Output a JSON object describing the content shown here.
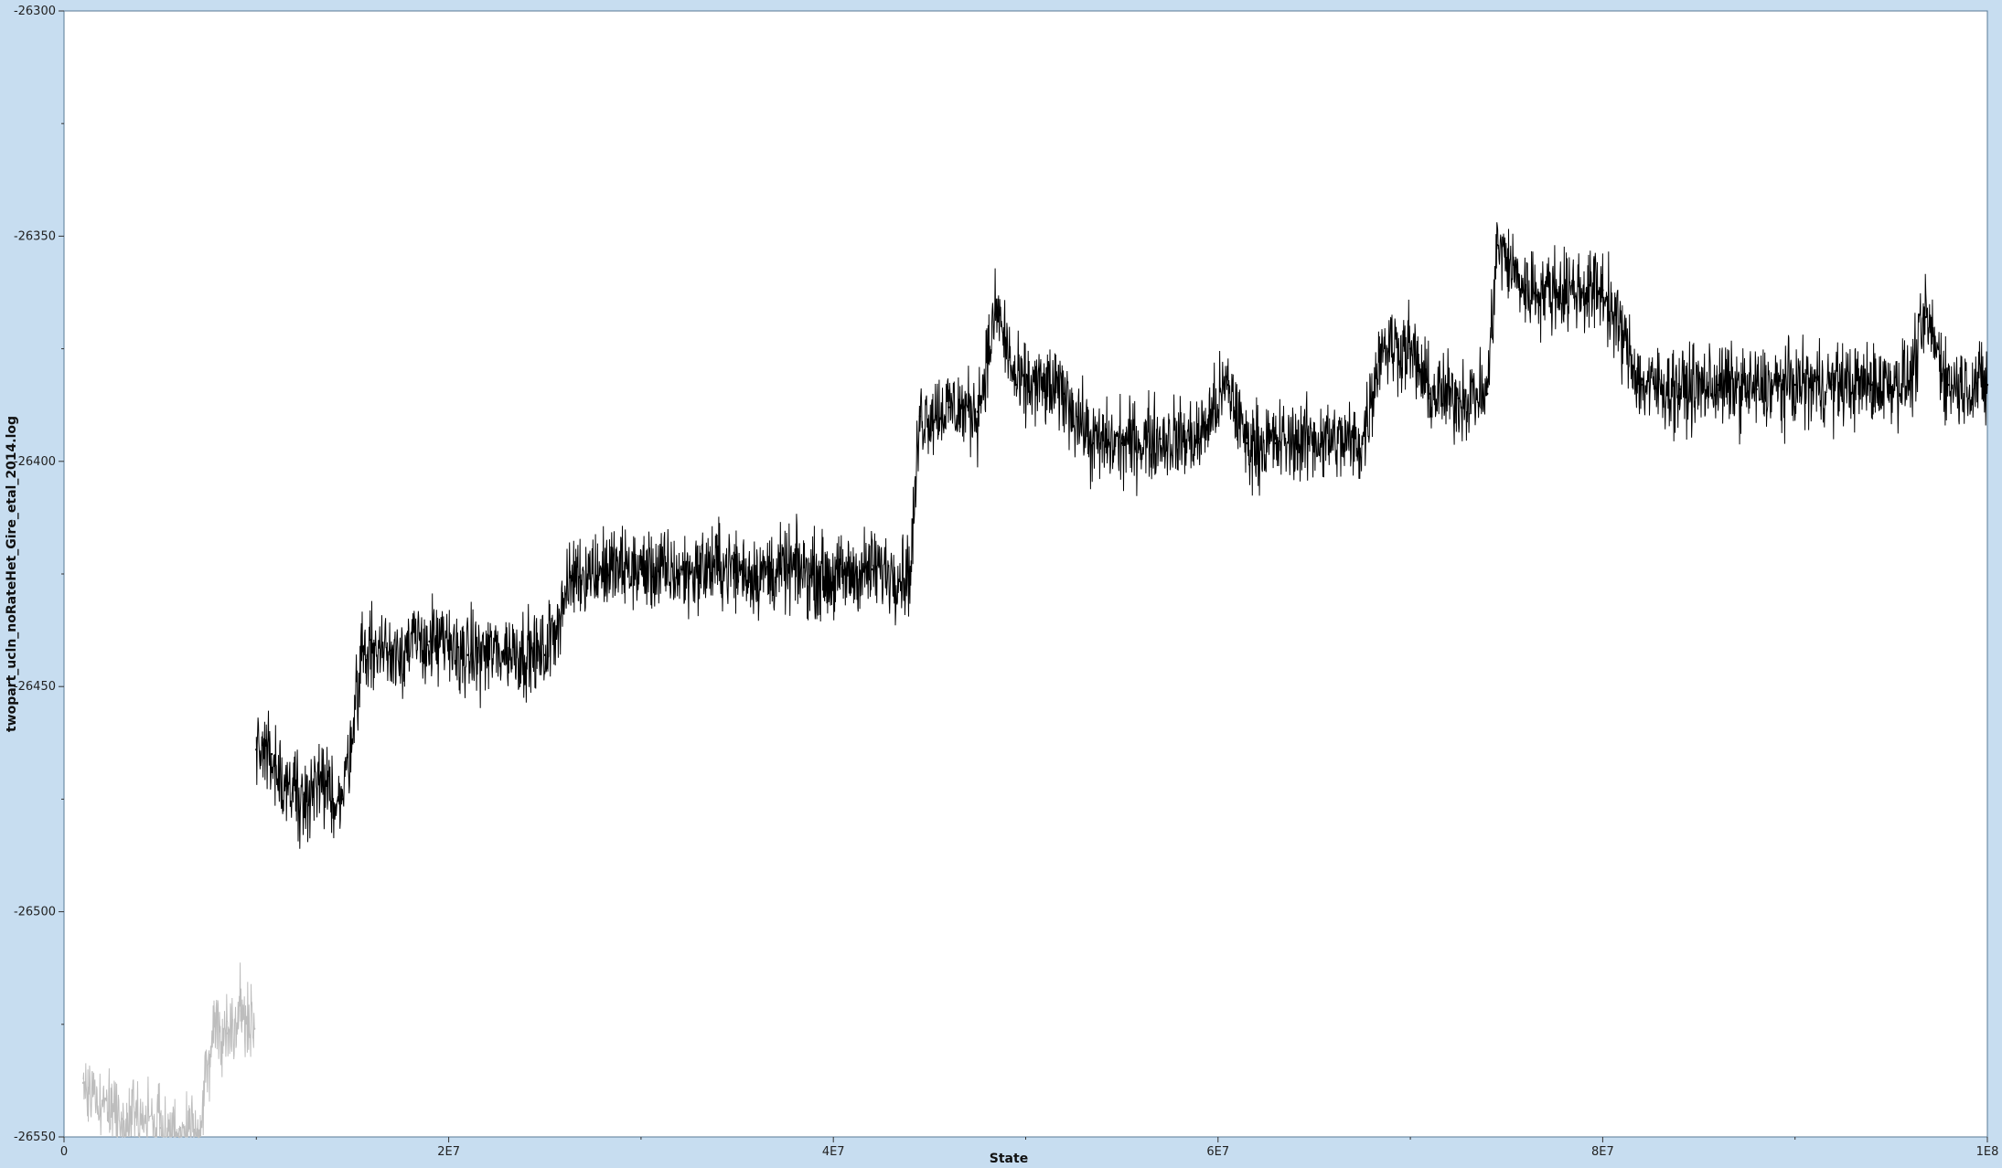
{
  "chart_data": {
    "type": "line",
    "title": "",
    "xlabel": "State",
    "ylabel": "twopart_ucln_noRateHet_Gire_etal_2014.log",
    "xlim": [
      0,
      100000000
    ],
    "ylim": [
      -26550,
      -26300
    ],
    "x_ticks": [
      {
        "value": 0,
        "label": "0"
      },
      {
        "value": 20000000,
        "label": "2E7"
      },
      {
        "value": 40000000,
        "label": "4E7"
      },
      {
        "value": 60000000,
        "label": "6E7"
      },
      {
        "value": 80000000,
        "label": "8E7"
      },
      {
        "value": 100000000,
        "label": "1E8"
      }
    ],
    "y_ticks": [
      {
        "value": -26550,
        "label": "-26550"
      },
      {
        "value": -26500,
        "label": "-26500"
      },
      {
        "value": -26450,
        "label": "-26450"
      },
      {
        "value": -26400,
        "label": "-26400"
      },
      {
        "value": -26350,
        "label": "-26350"
      },
      {
        "value": -26300,
        "label": "-26300"
      }
    ],
    "grid": false,
    "series": [
      {
        "role": "burn-in",
        "color": "#bdbdbd",
        "x": [
          1000000,
          2000000,
          3000000,
          4000000,
          5000000,
          6000000,
          7000000,
          7800000,
          8500000,
          9200000,
          9900000
        ],
        "values": [
          -26538,
          -26542,
          -26546,
          -26545,
          -26548,
          -26550,
          -26550,
          -26525,
          -26527,
          -26522,
          -26526
        ]
      },
      {
        "role": "post-burn-in",
        "color": "#000000",
        "x": [
          10000000,
          10800000,
          11500000,
          12500000,
          13500000,
          14500000,
          15500000,
          17000000,
          19000000,
          21000000,
          23000000,
          25000000,
          26500000,
          28000000,
          30000000,
          32000000,
          34000000,
          36000000,
          38000000,
          40000000,
          42000000,
          44000000,
          44500000,
          46000000,
          47500000,
          48500000,
          49500000,
          50500000,
          52000000,
          53500000,
          55000000,
          57000000,
          59000000,
          60500000,
          61500000,
          63000000,
          65000000,
          67500000,
          68500000,
          70000000,
          71000000,
          72500000,
          74000000,
          74500000,
          76000000,
          78000000,
          80000000,
          81000000,
          82000000,
          84000000,
          86000000,
          88000000,
          90000000,
          92000000,
          94000000,
          96000000,
          96800000,
          98000000,
          100000000
        ],
        "values": [
          -26464,
          -26465,
          -26472,
          -26474,
          -26473,
          -26475,
          -26442,
          -26442,
          -26440,
          -26443,
          -26442,
          -26443,
          -26425,
          -26424,
          -26424,
          -26425,
          -26423,
          -26425,
          -26424,
          -26426,
          -26424,
          -26425,
          -26390,
          -26388,
          -26389,
          -26366,
          -26383,
          -26383,
          -26385,
          -26396,
          -26396,
          -26395,
          -26395,
          -26383,
          -26396,
          -26396,
          -26395,
          -26396,
          -26374,
          -26375,
          -26385,
          -26386,
          -26385,
          -26352,
          -26362,
          -26362,
          -26362,
          -26372,
          -26383,
          -26384,
          -26383,
          -26384,
          -26383,
          -26383,
          -26383,
          -26382,
          -26368,
          -26383,
          -26383
        ]
      }
    ]
  }
}
